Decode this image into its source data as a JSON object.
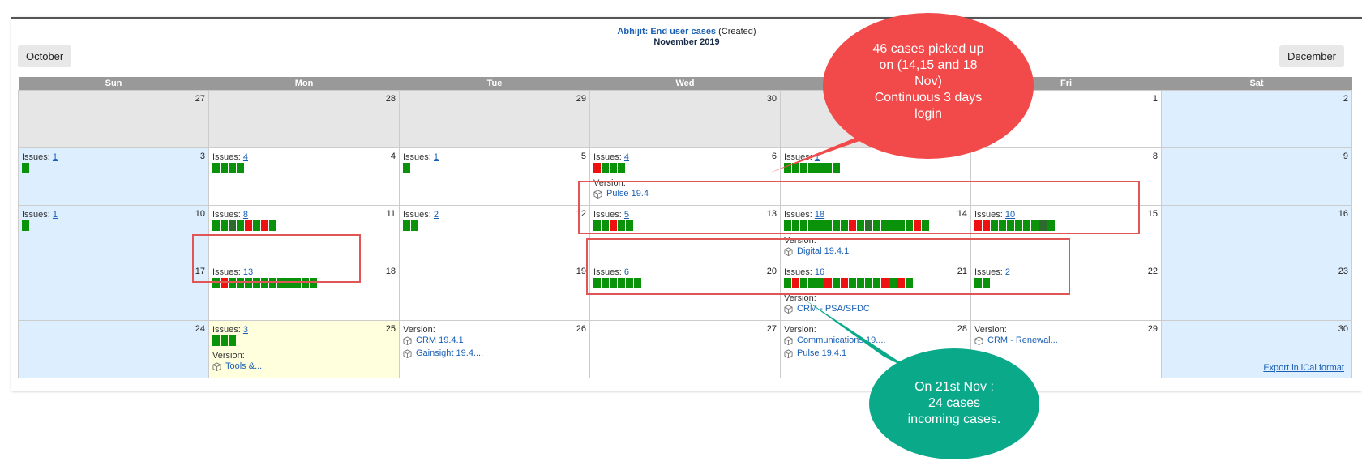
{
  "header": {
    "filter_link": "Abhijit: End user cases",
    "filter_suffix": "(Created)",
    "month": "November 2019"
  },
  "nav": {
    "prev": "October",
    "next": "December"
  },
  "weekdays": [
    "Sun",
    "Mon",
    "Tue",
    "Wed",
    "Thu",
    "Fri",
    "Sat"
  ],
  "labels": {
    "issues": "Issues:",
    "version": "Version:"
  },
  "cells": {
    "c27a": "27",
    "c28a": "28",
    "c29a": "29",
    "c30a": "30",
    "c1": "1",
    "c2": "2",
    "c3": "3",
    "c4": "4",
    "c5": "5",
    "c6": "6",
    "c8": "8",
    "c9": "9",
    "c10": "10",
    "c11": "11",
    "c12": "12",
    "c13": "13",
    "c14": "14",
    "c15": "15",
    "c16": "16",
    "c17": "17",
    "c18": "18",
    "c19": "19",
    "c20": "20",
    "c21": "21",
    "c22": "22",
    "c23": "23",
    "c24": "24",
    "c25": "25",
    "c26": "26",
    "c27": "27",
    "c28": "28",
    "c29": "29",
    "c30": "30"
  },
  "issues": {
    "d3": "1",
    "d4": "4",
    "d5": "1",
    "d6": "4",
    "d7": "1",
    "d10": "1",
    "d11": "8",
    "d12": "2",
    "d13": "5",
    "d14": "18",
    "d15": "10",
    "d18": "13",
    "d20": "6",
    "d21": "16",
    "d22": "2",
    "d25": "3"
  },
  "versions": {
    "d6": "Pulse 19.4",
    "d14": "Digital 19.4.1",
    "d21": "CRM - PSA/SFDC",
    "d25": "Tools &...",
    "d26a": "CRM 19.4.1",
    "d26b": "Gainsight 19.4....",
    "d28a": "Communications 19....",
    "d28b": "Pulse 19.4.1",
    "d29": "CRM - Renewal..."
  },
  "bar_colors": {
    "d3": [
      "g"
    ],
    "d4": [
      "g",
      "g",
      "g",
      "g"
    ],
    "d5": [
      "g"
    ],
    "d6": [
      "r",
      "g",
      "g",
      "g"
    ],
    "d7": [
      "g",
      "g",
      "g",
      "g",
      "g",
      "g",
      "g"
    ],
    "d10": [
      "g"
    ],
    "d11": [
      "g",
      "g",
      "d",
      "g",
      "r",
      "g",
      "r",
      "g"
    ],
    "d12": [
      "g",
      "g"
    ],
    "d13": [
      "g",
      "g",
      "r",
      "g",
      "g"
    ],
    "d14": [
      "g",
      "g",
      "g",
      "g",
      "g",
      "g",
      "g",
      "g",
      "r",
      "g",
      "d",
      "g",
      "g",
      "g",
      "g",
      "g",
      "r",
      "g"
    ],
    "d15": [
      "r",
      "r",
      "g",
      "g",
      "g",
      "g",
      "g",
      "g",
      "d",
      "g"
    ],
    "d18": [
      "g",
      "r",
      "g",
      "g",
      "g",
      "g",
      "g",
      "g",
      "g",
      "g",
      "g",
      "g",
      "g"
    ],
    "d20": [
      "g",
      "g",
      "g",
      "g",
      "g",
      "g"
    ],
    "d21": [
      "g",
      "r",
      "g",
      "g",
      "g",
      "r",
      "g",
      "r",
      "g",
      "g",
      "g",
      "g",
      "r",
      "g",
      "r",
      "g"
    ],
    "d22": [
      "g",
      "g"
    ],
    "d25": [
      "g",
      "g",
      "g"
    ]
  },
  "colors": {
    "ok": "#0a930a",
    "fail": "#ee1111",
    "dark": "#2d6a2d",
    "callout_red": "#f24a4a",
    "callout_green": "#0aa98a"
  },
  "export": "Export in iCal format",
  "annotations": {
    "red_callout": [
      "46 cases picked up",
      "on (14,15 and 18",
      "Nov)",
      "Continuous 3 days",
      "login"
    ],
    "green_callout": [
      "On 21st Nov :",
      "24 cases",
      "incoming cases."
    ]
  }
}
